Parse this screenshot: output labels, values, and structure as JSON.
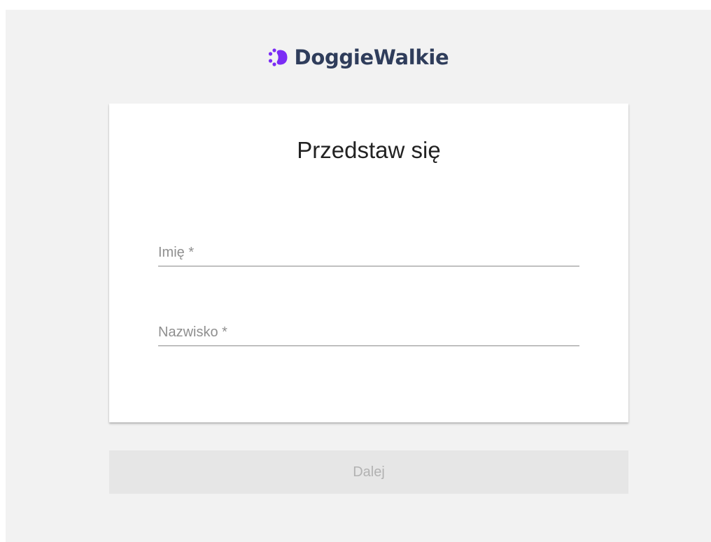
{
  "brand": {
    "name": "DoggieWalkie",
    "icon": "paw-icon",
    "icon_color": "#7b2cf5",
    "text_color": "#2f3d5b"
  },
  "card": {
    "title": "Przedstaw się"
  },
  "form": {
    "first_name": {
      "label": "Imię *",
      "value": ""
    },
    "last_name": {
      "label": "Nazwisko *",
      "value": ""
    }
  },
  "actions": {
    "next_label": "Dalej",
    "next_disabled": true
  },
  "colors": {
    "background": "#f2f2f2",
    "card": "#ffffff",
    "button_disabled_bg": "#e6e6e6",
    "button_disabled_text": "#b2b2b2"
  }
}
